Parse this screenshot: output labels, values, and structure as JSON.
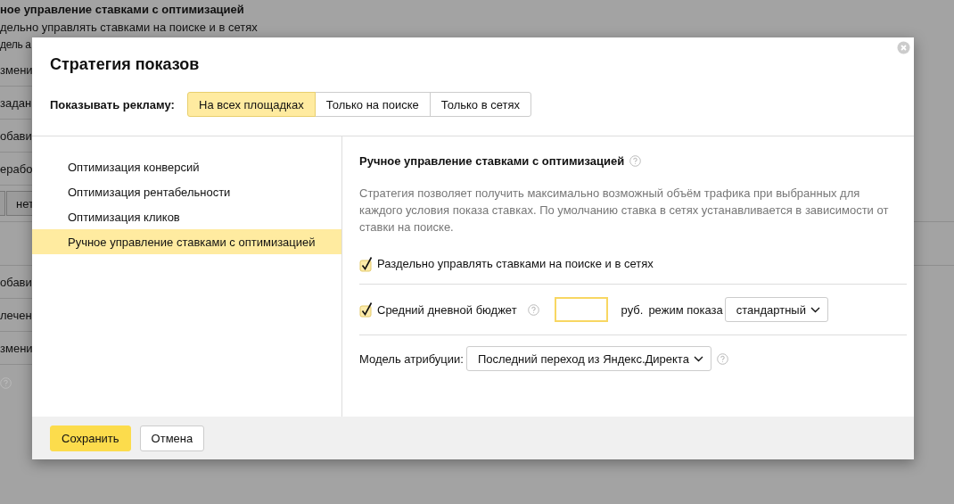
{
  "background": {
    "rows": [
      {
        "kind": "heading",
        "text": "ное управление ставками с оптимизацией"
      },
      {
        "kind": "text",
        "text": "дельно управлять ставками на поиске и в сетях"
      },
      {
        "kind": "text",
        "text": "дель а"
      },
      {
        "kind": "text",
        "text": "змени"
      },
      {
        "kind": "text",
        "text": "задан"
      },
      {
        "kind": "text",
        "text": "обави"
      },
      {
        "kind": "text",
        "text": "ерабо"
      },
      {
        "kind": "button",
        "text": "нет"
      },
      {
        "kind": "blank"
      },
      {
        "kind": "text",
        "text": "обави"
      },
      {
        "kind": "text",
        "text": "лечен"
      },
      {
        "kind": "text",
        "text": "змени"
      },
      {
        "kind": "help"
      }
    ]
  },
  "dialog": {
    "title": "Стратегия показов",
    "show_ads": {
      "label": "Показывать рекламу:",
      "options": [
        {
          "label": "На всех площадках",
          "selected": true
        },
        {
          "label": "Только на поиске",
          "selected": false
        },
        {
          "label": "Только в сетях",
          "selected": false
        }
      ]
    },
    "strategies": [
      {
        "label": "Оптимизация конверсий",
        "selected": false
      },
      {
        "label": "Оптимизация рентабельности",
        "selected": false
      },
      {
        "label": "Оптимизация кликов",
        "selected": false
      },
      {
        "label": "Ручное управление ставками с оптимизацией",
        "selected": true
      }
    ],
    "panel": {
      "title": "Ручное управление ставками с оптимизацией",
      "description": "Стратегия позволяет получить максимально возможный объём трафика при выбранных для каждого условия показа ставках. По умолчанию ставка в сетях устанавливается в зависимости от ставки на поиске.",
      "separate_bids": {
        "label": "Раздельно управлять ставками на поиске и в сетях",
        "checked": true
      },
      "budget": {
        "label": "Средний дневной бюджет",
        "checked": true,
        "currency": "руб.",
        "mode_label": "режим показа",
        "mode_value": "стандартный"
      },
      "attribution": {
        "label": "Модель атрибуции:",
        "value": "Последний переход из Яндекс.Директа"
      }
    },
    "buttons": [
      {
        "kind": "primary",
        "label": "Сохранить"
      },
      {
        "kind": "secondary",
        "label": "Отмена"
      }
    ]
  }
}
